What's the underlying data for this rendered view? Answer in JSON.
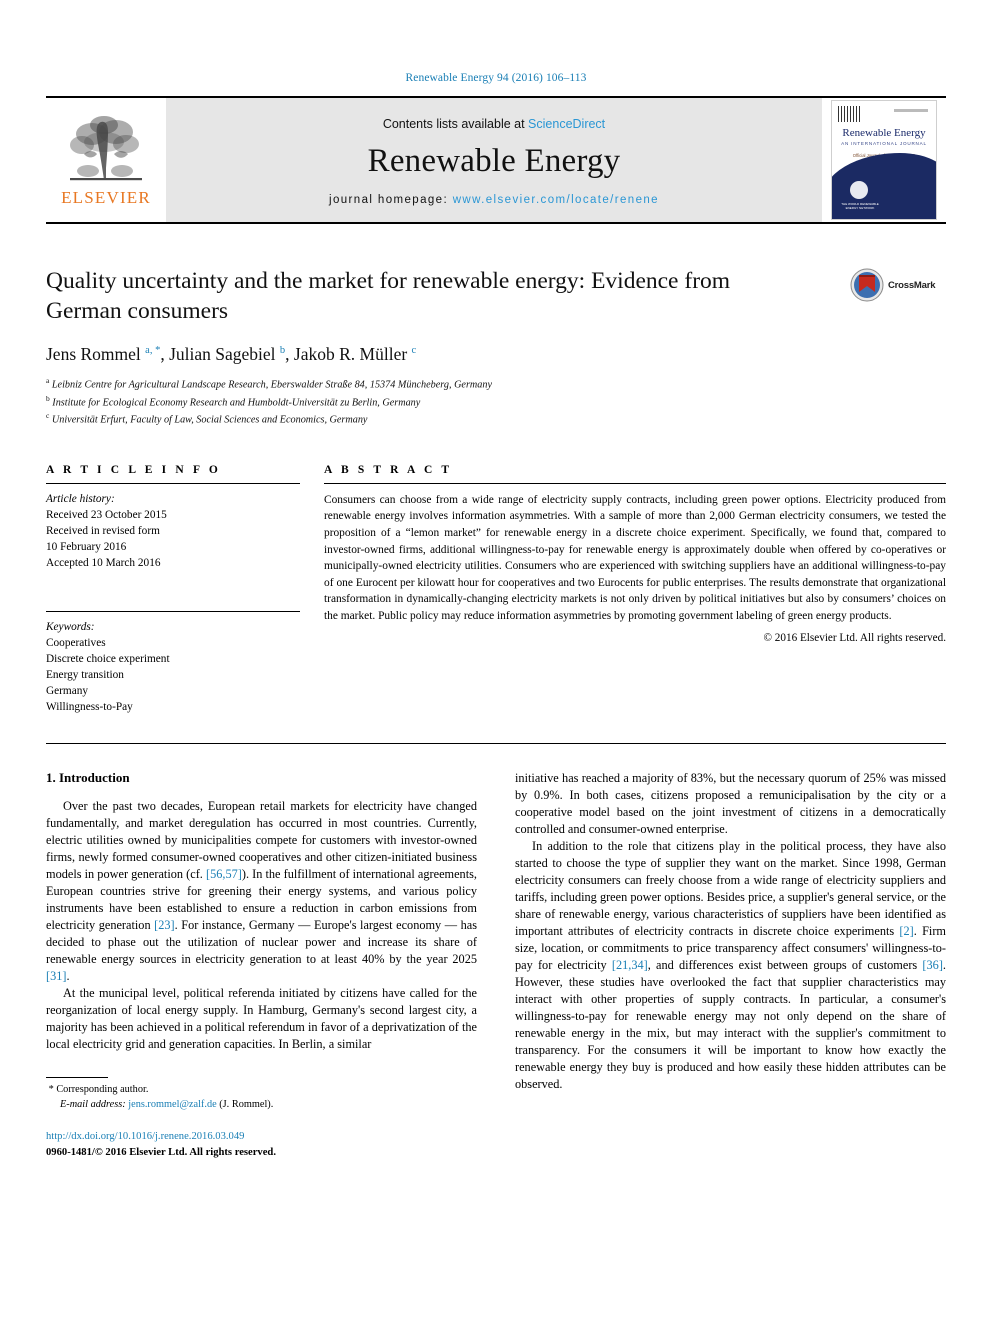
{
  "running_head": "Renewable Energy 94 (2016) 106–113",
  "masthead": {
    "publisher_name": "ELSEVIER",
    "contents_prefix": "Contents lists available at ",
    "contents_link": "ScienceDirect",
    "journal_title": "Renewable Energy",
    "homepage_label": "journal homepage: ",
    "homepage_url": "www.elsevier.com/locate/renene",
    "cover": {
      "title": "Renewable Energy",
      "subtitle": "AN INTERNATIONAL JOURNAL",
      "tagline": "Official Journal of WREN / WREC",
      "seal_text": "THE WORLD RENEWABLE ENERGY NETWORK"
    }
  },
  "article": {
    "title": "Quality uncertainty and the market for renewable energy: Evidence from German consumers",
    "crossmark_label": "CrossMark",
    "authors_html": "Jens Rommel <sup>a, *</sup>, Julian Sagebiel <sup>b</sup>, Jakob R. Müller <sup>c</sup>",
    "affiliations": [
      {
        "marker": "a",
        "text": "Leibniz Centre for Agricultural Landscape Research, Eberswalder Straße 84, 15374 Müncheberg, Germany"
      },
      {
        "marker": "b",
        "text": "Institute for Ecological Economy Research and Humboldt-Universität zu Berlin, Germany"
      },
      {
        "marker": "c",
        "text": "Universität Erfurt, Faculty of Law, Social Sciences and Economics, Germany"
      }
    ]
  },
  "article_info": {
    "heading": "A R T I C L E   I N F O",
    "history_label": "Article history:",
    "history": [
      "Received 23 October 2015",
      "Received in revised form",
      "10 February 2016",
      "Accepted 10 March 2016"
    ],
    "keywords_label": "Keywords:",
    "keywords": [
      "Cooperatives",
      "Discrete choice experiment",
      "Energy transition",
      "Germany",
      "Willingness-to-Pay"
    ]
  },
  "abstract": {
    "heading": "A B S T R A C T",
    "text": "Consumers can choose from a wide range of electricity supply contracts, including green power options. Electricity produced from renewable energy involves information asymmetries. With a sample of more than 2,000 German electricity consumers, we tested the proposition of a “lemon market” for renewable energy in a discrete choice experiment. Specifically, we found that, compared to investor-owned firms, additional willingness-to-pay for renewable energy is approximately double when offered by co-operatives or municipally-owned electricity utilities. Consumers who are experienced with switching suppliers have an additional willingness-to-pay of one Eurocent per kilowatt hour for cooperatives and two Eurocents for public enterprises. The results demonstrate that organizational transformation in dynamically-changing electricity markets is not only driven by political initiatives but also by consumers’ choices on the market. Public policy may reduce information asymmetries by promoting government labeling of green energy products.",
    "copyright": "© 2016 Elsevier Ltd. All rights reserved."
  },
  "body": {
    "section_number_title": "1. Introduction",
    "left_paragraphs": [
      "Over the past two decades, European retail markets for electricity have changed fundamentally, and market deregulation has occurred in most countries. Currently, electric utilities owned by municipalities compete for customers with investor-owned firms, newly formed consumer-owned cooperatives and other citizen-initiated business models in power generation (cf. [56,57]). In the fulfillment of international agreements, European countries strive for greening their energy systems, and various policy instruments have been established to ensure a reduction in carbon emissions from electricity generation [23]. For instance, Germany — Europe's largest economy — has decided to phase out the utilization of nuclear power and increase its share of renewable energy sources in electricity generation to at least 40% by the year 2025 [31].",
      "At the municipal level, political referenda initiated by citizens have called for the reorganization of local energy supply. In Hamburg, Germany's second largest city, a majority has been achieved in a political referendum in favor of a deprivatization of the local electricity grid and generation capacities. In Berlin, a similar"
    ],
    "right_paragraphs": [
      "initiative has reached a majority of 83%, but the necessary quorum of 25% was missed by 0.9%. In both cases, citizens proposed a remunicipalisation by the city or a cooperative model based on the joint investment of citizens in a democratically controlled and consumer-owned enterprise.",
      "In addition to the role that citizens play in the political process, they have also started to choose the type of supplier they want on the market. Since 1998, German electricity consumers can freely choose from a wide range of electricity suppliers and tariffs, including green power options. Besides price, a supplier's general service, or the share of renewable energy, various characteristics of suppliers have been identified as important attributes of electricity contracts in discrete choice experiments [2]. Firm size, location, or commitments to price transparency affect consumers' willingness-to-pay for electricity [21,34], and differences exist between groups of customers [36]. However, these studies have overlooked the fact that supplier characteristics may interact with other properties of supply contracts. In particular, a consumer's willingness-to-pay for renewable energy may not only depend on the share of renewable energy in the mix, but may interact with the supplier's commitment to transparency. For the consumers it will be important to know how exactly the renewable energy they buy is produced and how easily these hidden attributes can be observed."
    ]
  },
  "footer": {
    "corresponding_marker": "*",
    "corresponding_label": "Corresponding author.",
    "email_label": "E-mail address:",
    "email": "jens.rommel@zalf.de",
    "email_owner": "(J. Rommel).",
    "doi": "http://dx.doi.org/10.1016/j.renene.2016.03.049",
    "issn_line": "0960-1481/© 2016 Elsevier Ltd. All rights reserved."
  },
  "colors": {
    "link_blue": "#1a7fb5",
    "sciencedirect_blue": "#2a96d4",
    "elsevier_orange": "#E87722",
    "masthead_gray": "#e6e6e6"
  }
}
